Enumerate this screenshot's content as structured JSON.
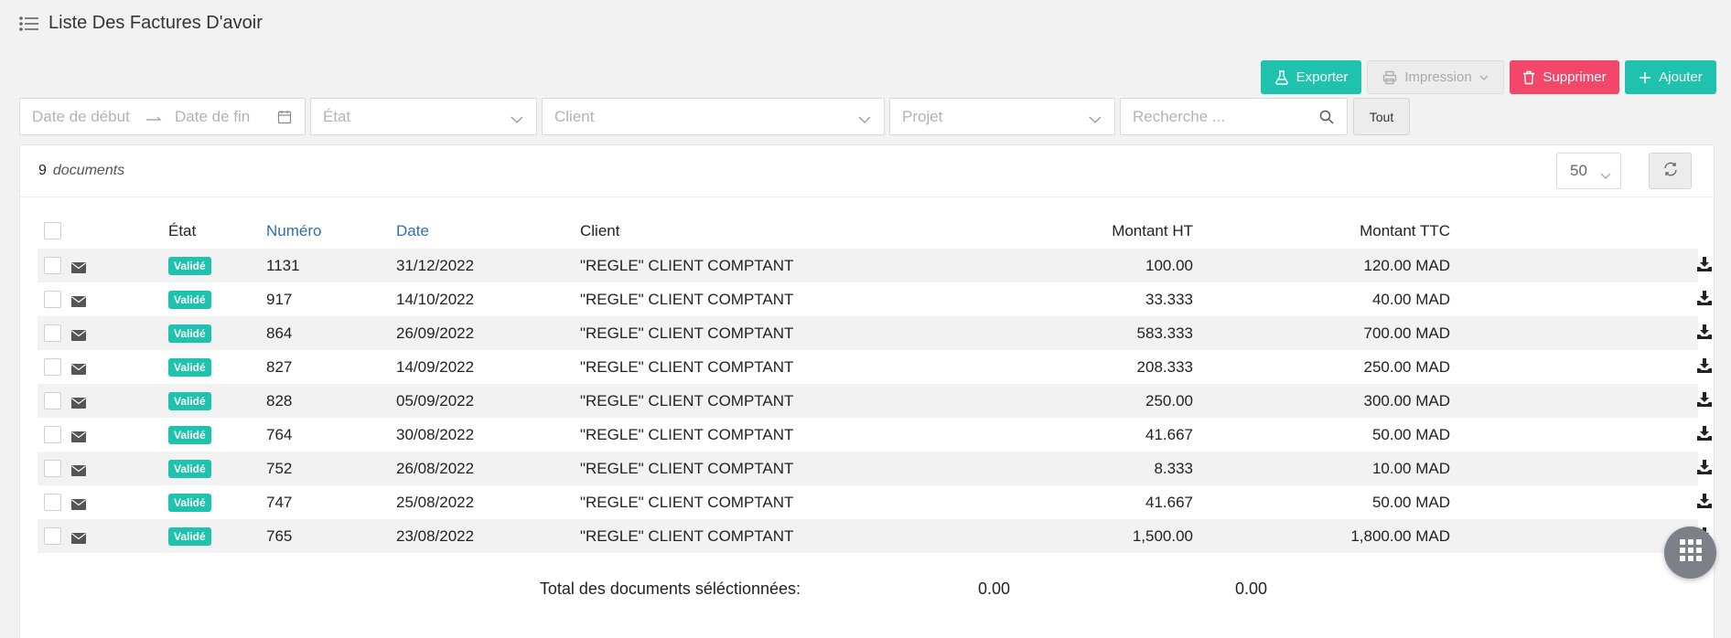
{
  "header": {
    "title": "Liste Des Factures D'avoir"
  },
  "toolbar": {
    "export_label": "Exporter",
    "print_label": "Impression",
    "delete_label": "Supprimer",
    "add_label": "Ajouter"
  },
  "filters": {
    "date_start_placeholder": "Date de début",
    "date_end_placeholder": "Date de fin",
    "state_placeholder": "État",
    "client_placeholder": "Client",
    "project_placeholder": "Projet",
    "search_placeholder": "Recherche ...",
    "all_label": "Tout"
  },
  "summary": {
    "count": "9",
    "count_label": "documents",
    "page_size": "50"
  },
  "table": {
    "columns": {
      "state": "État",
      "number": "Numéro",
      "date": "Date",
      "client": "Client",
      "amount_ht": "Montant HT",
      "amount_ttc": "Montant TTC"
    },
    "rows": [
      {
        "state": "Validé",
        "number": "1131",
        "date": "31/12/2022",
        "client": "\"REGLE\" CLIENT COMPTANT",
        "amount_ht": "100.00",
        "amount_ttc": "120.00 MAD"
      },
      {
        "state": "Validé",
        "number": "917",
        "date": "14/10/2022",
        "client": "\"REGLE\" CLIENT COMPTANT",
        "amount_ht": "33.333",
        "amount_ttc": "40.00 MAD"
      },
      {
        "state": "Validé",
        "number": "864",
        "date": "26/09/2022",
        "client": "\"REGLE\" CLIENT COMPTANT",
        "amount_ht": "583.333",
        "amount_ttc": "700.00 MAD"
      },
      {
        "state": "Validé",
        "number": "827",
        "date": "14/09/2022",
        "client": "\"REGLE\" CLIENT COMPTANT",
        "amount_ht": "208.333",
        "amount_ttc": "250.00 MAD"
      },
      {
        "state": "Validé",
        "number": "828",
        "date": "05/09/2022",
        "client": "\"REGLE\" CLIENT COMPTANT",
        "amount_ht": "250.00",
        "amount_ttc": "300.00 MAD"
      },
      {
        "state": "Validé",
        "number": "764",
        "date": "30/08/2022",
        "client": "\"REGLE\" CLIENT COMPTANT",
        "amount_ht": "41.667",
        "amount_ttc": "50.00 MAD"
      },
      {
        "state": "Validé",
        "number": "752",
        "date": "26/08/2022",
        "client": "\"REGLE\" CLIENT COMPTANT",
        "amount_ht": "8.333",
        "amount_ttc": "10.00 MAD"
      },
      {
        "state": "Validé",
        "number": "747",
        "date": "25/08/2022",
        "client": "\"REGLE\" CLIENT COMPTANT",
        "amount_ht": "41.667",
        "amount_ttc": "50.00 MAD"
      },
      {
        "state": "Validé",
        "number": "765",
        "date": "23/08/2022",
        "client": "\"REGLE\" CLIENT COMPTANT",
        "amount_ht": "1,500.00",
        "amount_ttc": "1,800.00 MAD"
      }
    ]
  },
  "totals": {
    "label": "Total des documents séléctionnées:",
    "amount_ht": "0.00",
    "amount_ttc": "0.00"
  },
  "icons": {
    "menu": "list-icon",
    "export": "flask-icon",
    "print": "printer-icon",
    "delete": "trash-icon",
    "add": "plus-icon",
    "calendar": "calendar-icon",
    "search": "search-icon",
    "refresh": "refresh-icon",
    "mail": "envelope-icon",
    "download": "download-icon",
    "apps": "grid-icon"
  },
  "colors": {
    "accent": "#1ec2ad",
    "danger": "#f2466b",
    "link": "#2f6fb3"
  }
}
